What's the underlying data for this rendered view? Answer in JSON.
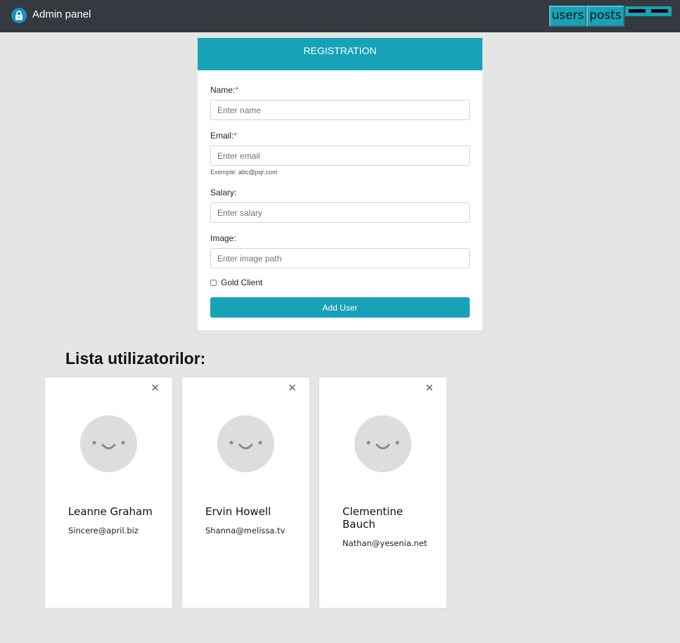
{
  "header": {
    "title": "Admin panel",
    "icon": "lock-icon",
    "nav": {
      "users": "users",
      "posts": "posts"
    }
  },
  "form": {
    "title": "REGISTRATION",
    "required_mark": "*",
    "name": {
      "label": "Name:",
      "placeholder": "Enter name",
      "value": ""
    },
    "email": {
      "label": "Email:",
      "placeholder": "Enter email",
      "value": "",
      "hint": "Exemple: abc@pqr.com"
    },
    "salary": {
      "label": "Salary:",
      "placeholder": "Enter salary",
      "value": ""
    },
    "image": {
      "label": "Image:",
      "placeholder": "Enter image path",
      "value": ""
    },
    "gold_client": {
      "label": "Gold Client",
      "checked": false
    },
    "submit_label": "Add User"
  },
  "users_section": {
    "heading": "Lista utilizatorilor:",
    "close_glyph": "✕",
    "users": [
      {
        "name": "Leanne Graham",
        "email": "Sincere@april.biz"
      },
      {
        "name": "Ervin Howell",
        "email": "Shanna@melissa.tv"
      },
      {
        "name": "Clementine Bauch",
        "email": "Nathan@yesenia.net"
      }
    ]
  },
  "colors": {
    "topbar": "#343a40",
    "accent": "#17a2b8",
    "background": "#e4e5e4",
    "required": "#dc3545",
    "avatar": "#dddddd"
  }
}
